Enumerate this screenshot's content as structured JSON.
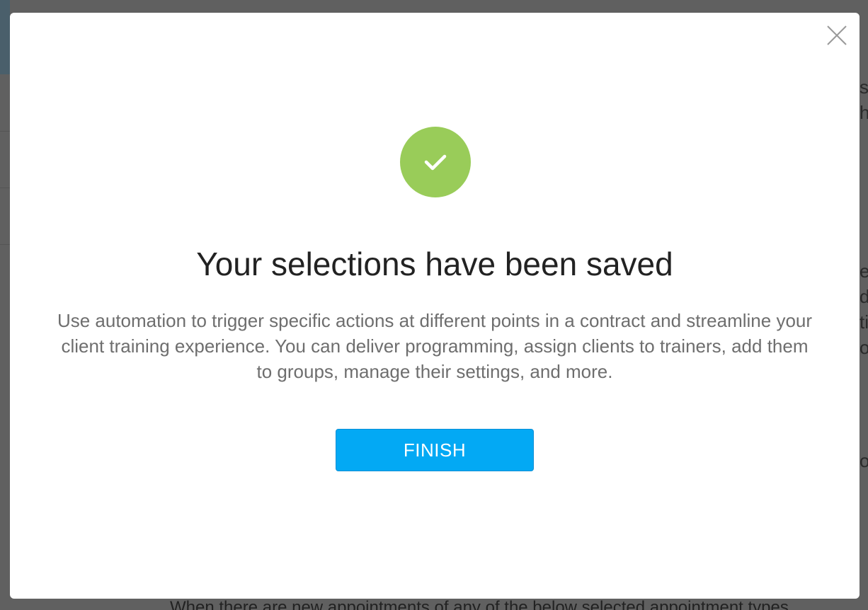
{
  "modal": {
    "title": "Your selections have been saved",
    "description": "Use automation to trigger specific actions at different points in a contract and streamline your client training experience. You can deliver programming, assign clients to trainers, add them to groups, manage their settings, and more.",
    "finish_label": "FINISH",
    "success_color": "#99cc59",
    "button_color": "#03a9f4"
  },
  "background": {
    "right_fragments": [
      "se",
      "h",
      "ea",
      "d",
      "ti",
      "o",
      "o"
    ],
    "bottom_text": "When there are new appointments of any of the below selected appointment types"
  }
}
